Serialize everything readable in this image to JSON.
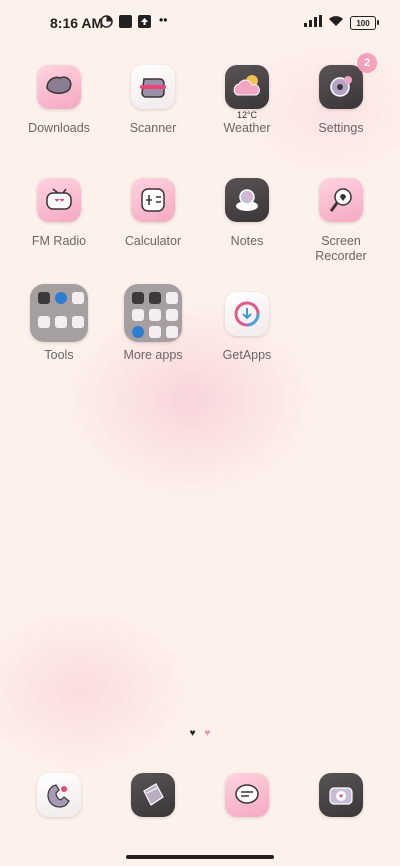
{
  "status": {
    "time": "8:16 AM",
    "battery": "100"
  },
  "apps": [
    {
      "label": "Downloads"
    },
    {
      "label": "Scanner"
    },
    {
      "label": "Weather",
      "temp": "12°C"
    },
    {
      "label": "Settings",
      "badge": "2"
    },
    {
      "label": "FM Radio"
    },
    {
      "label": "Calculator"
    },
    {
      "label": "Notes"
    },
    {
      "label": "Screen Recorder"
    },
    {
      "label": "Tools"
    },
    {
      "label": "More apps"
    },
    {
      "label": "GetApps"
    }
  ],
  "pager": {
    "dots": [
      "♥",
      "♥"
    ]
  }
}
